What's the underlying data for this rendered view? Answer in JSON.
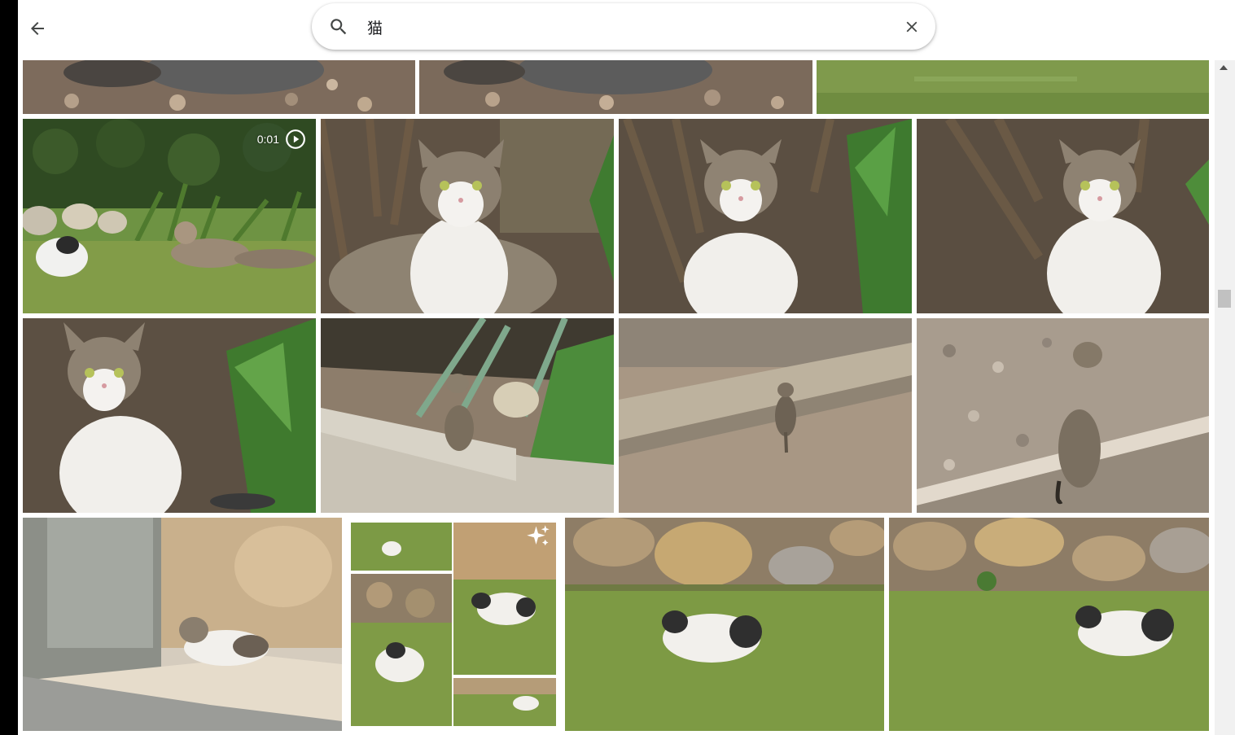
{
  "search": {
    "query": "猫"
  },
  "video": {
    "duration": "0:01"
  },
  "icons": {
    "back": "arrow-left-icon",
    "search": "magnifier-icon",
    "clear": "close-icon",
    "play": "play-circle-icon",
    "autocreate": "sparkle-icon"
  },
  "colors": {
    "header_bg": "#ffffff",
    "left_bar": "#000000",
    "icon": "#444746"
  }
}
